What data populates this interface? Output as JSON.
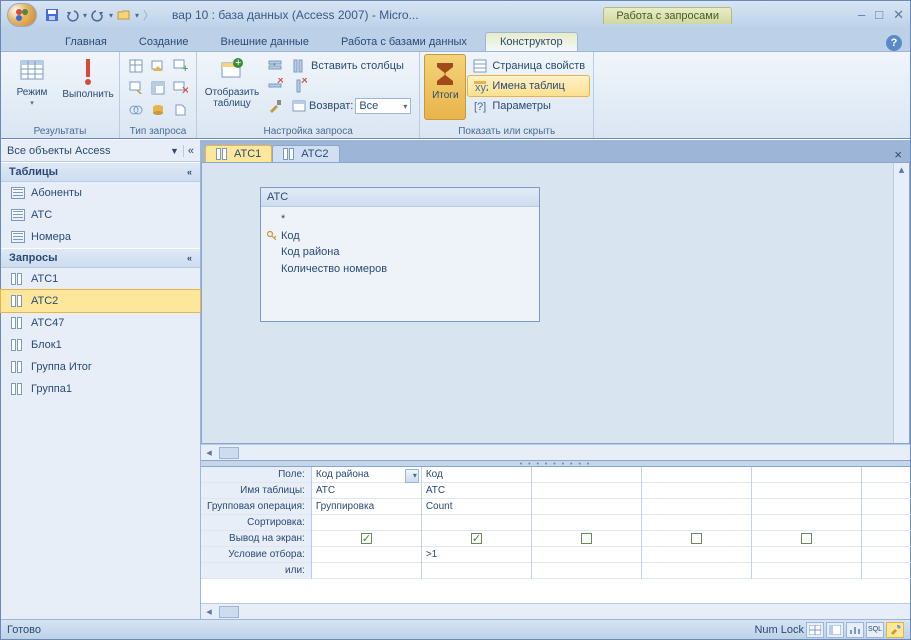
{
  "title": "вар 10 : база данных (Access 2007) - Micro...",
  "context_tab_group": "Работа с запросами",
  "ribbon_tabs": [
    "Главная",
    "Создание",
    "Внешние данные",
    "Работа с базами данных",
    "Конструктор"
  ],
  "active_ribbon_tab": 4,
  "ribbon": {
    "results": {
      "mode": "Режим",
      "run": "Выполнить",
      "label": "Результаты"
    },
    "qtype": {
      "label": "Тип запроса"
    },
    "setup": {
      "show_table": "Отобразить таблицу",
      "insert_cols": "Вставить столбцы",
      "delete_cols": "Удалить столбцы",
      "return": "Возврат:",
      "return_val": "Все",
      "label": "Настройка запроса"
    },
    "totals_btn": "Итоги",
    "showhide": {
      "prop_sheet": "Страница свойств",
      "table_names": "Имена таблиц",
      "params": "Параметры",
      "label": "Показать или скрыть"
    }
  },
  "nav": {
    "header": "Все объекты Access",
    "groups": [
      {
        "name": "Таблицы",
        "type": "table",
        "items": [
          "Абоненты",
          "АТС",
          "Номера"
        ]
      },
      {
        "name": "Запросы",
        "type": "query",
        "items": [
          "АТС1",
          "АТС2",
          "АТС47",
          "Блок1",
          "Группа Итог",
          "Группа1"
        ]
      }
    ],
    "selected": "АТС2"
  },
  "doc_tabs": [
    "АТС1",
    "АТС2"
  ],
  "active_doc_tab": 0,
  "table_card": {
    "title": "АТС",
    "fields": [
      "*",
      "Код",
      "Код района",
      "Количество номеров"
    ],
    "key_index": 1
  },
  "qbe": {
    "rows": [
      "Поле:",
      "Имя таблицы:",
      "Групповая операция:",
      "Сортировка:",
      "Вывод на экран:",
      "Условие отбора:",
      "или:"
    ],
    "cols": [
      {
        "field": "Код района",
        "table": "АТС",
        "op": "Группировка",
        "sort": "",
        "show": true,
        "criteria": "",
        "or": ""
      },
      {
        "field": "Код",
        "table": "АТС",
        "op": "Count",
        "sort": "",
        "show": true,
        "criteria": ">1",
        "or": ""
      },
      {
        "field": "",
        "table": "",
        "op": "",
        "sort": "",
        "show": false,
        "criteria": "",
        "or": ""
      },
      {
        "field": "",
        "table": "",
        "op": "",
        "sort": "",
        "show": false,
        "criteria": "",
        "or": ""
      },
      {
        "field": "",
        "table": "",
        "op": "",
        "sort": "",
        "show": false,
        "criteria": "",
        "or": ""
      },
      {
        "field": "",
        "table": "",
        "op": "",
        "sort": "",
        "show": false,
        "criteria": "",
        "or": ""
      }
    ]
  },
  "status": {
    "ready": "Готово",
    "numlock": "Num Lock",
    "sql": "SQL"
  }
}
